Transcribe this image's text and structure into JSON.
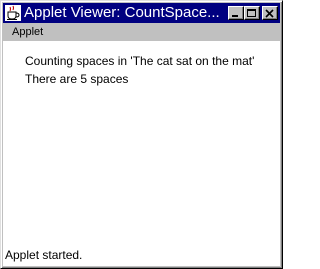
{
  "window": {
    "title": "Applet Viewer: CountSpace...",
    "icons": {
      "app": "java-cup-icon",
      "minimize": "minimize-icon",
      "maximize": "maximize-icon",
      "close": "close-icon"
    },
    "colors": {
      "titlebar": "#000080",
      "chrome": "#c0c0c0",
      "content": "#ffffff"
    }
  },
  "menubar": {
    "items": [
      {
        "label": "Applet"
      }
    ]
  },
  "applet": {
    "lines": [
      "Counting spaces in 'The cat sat on the mat'",
      "There are 5 spaces"
    ]
  },
  "status": {
    "text": "Applet started."
  }
}
